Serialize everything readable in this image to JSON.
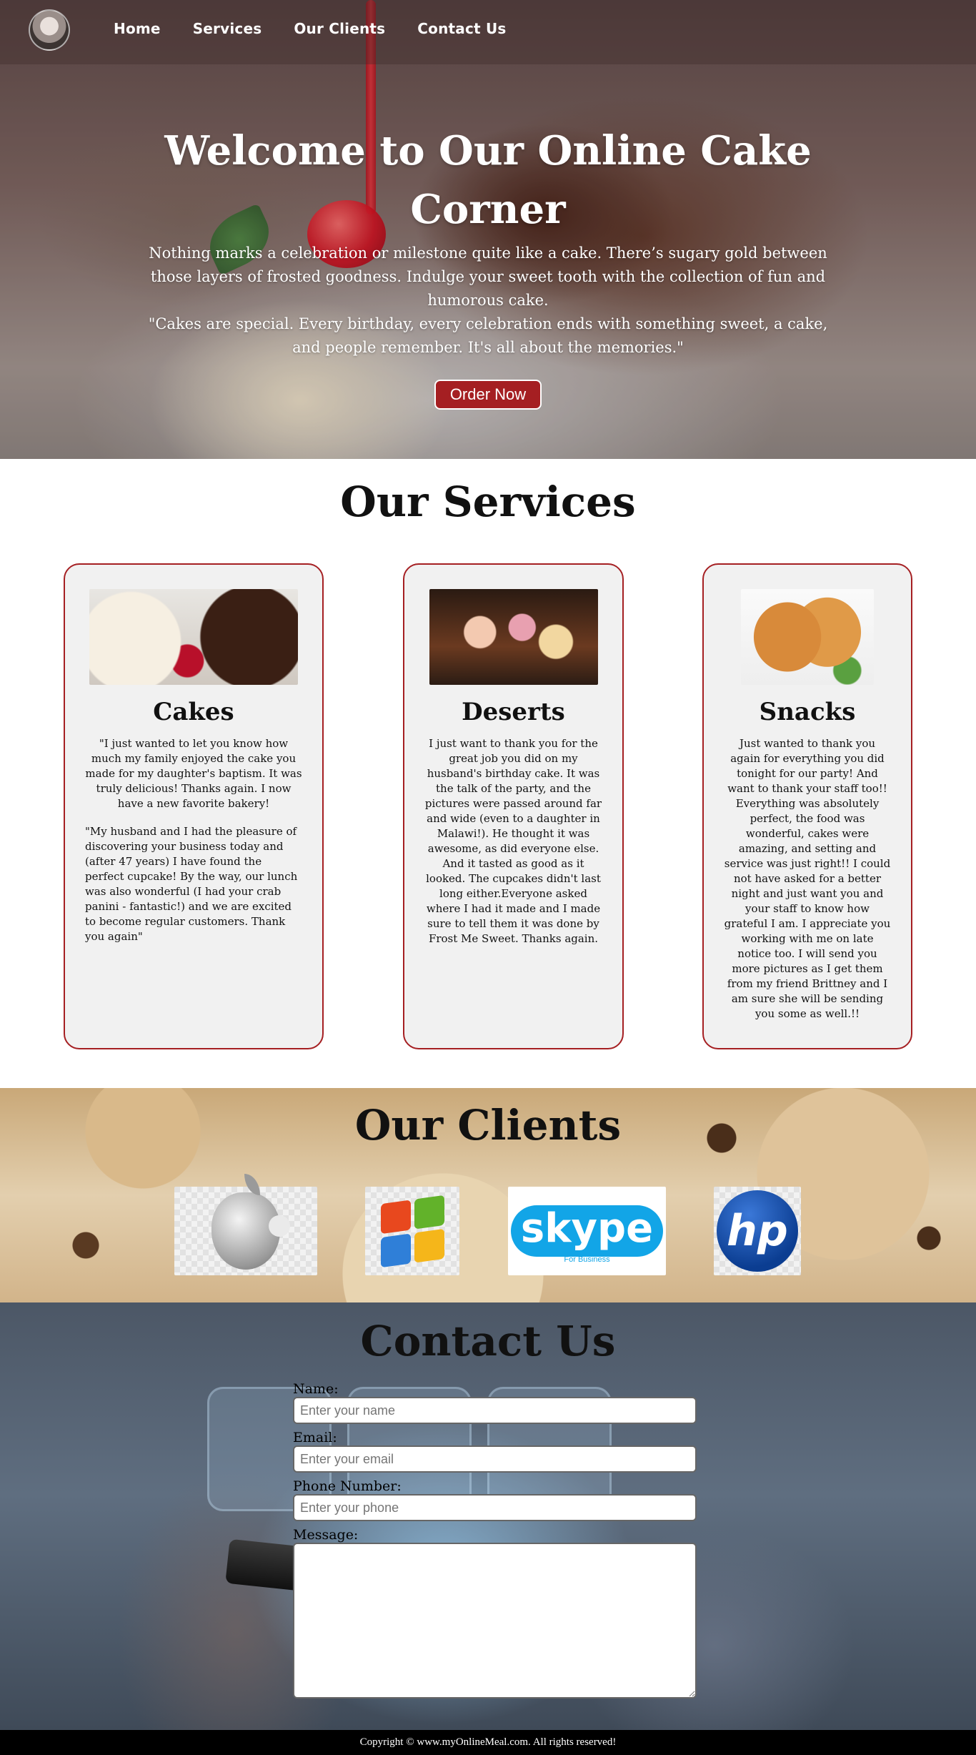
{
  "nav": {
    "avatar_icon": "profile-avatar",
    "links": [
      "Home",
      "Services",
      "Our Clients",
      "Contact Us"
    ]
  },
  "hero": {
    "title": "Welcome to Our Online Cake Corner",
    "paragraph": "Nothing marks a celebration or milestone quite like a cake. There’s sugary gold between those layers of frosted goodness. Indulge your sweet tooth with the collection of fun and humorous cake.",
    "quote": "\"Cakes are special. Every birthday, every celebration ends with something sweet, a cake, and people remember. It's all about the memories.\"",
    "button_label": "Order Now",
    "accent_color": "#a51f22"
  },
  "services": {
    "title": "Our Services",
    "cards": [
      {
        "title": "Cakes",
        "texts": [
          "\"I just wanted to let you know how much my family enjoyed the cake you made for my daughter's baptism. It was truly delicious! Thanks again. I now have a new favorite bakery!",
          "\"My husband and I had the pleasure of discovering your business today and (after 47 years) I have found the perfect cupcake! By the way, our lunch was also wonderful (I had your crab panini - fantastic!) and we are excited to become regular customers. Thank you again\""
        ]
      },
      {
        "title": "Deserts",
        "texts": [
          "I just want to thank you for the great job you did on my husband's birthday cake. It was the talk of the party, and the pictures were passed around far and wide (even to a daughter in Malawi!). He thought it was awesome, as did everyone else. And it tasted as good as it looked. The cupcakes didn't last long either.Everyone asked where I had it made and I made sure to tell them it was done by Frost Me Sweet. Thanks again."
        ]
      },
      {
        "title": "Snacks",
        "texts": [
          "Just wanted to thank you again for everything you did tonight for our party! And want to thank your staff too!! Everything was absolutely perfect, the food was wonderful, cakes were amazing, and setting and service was just right!! I could not have asked for a better night and just want you and your staff to know how grateful I am. I appreciate you working with me on late notice too. I will send you more pictures as I get them from my friend Brittney and I am sure she will be sending you some as well.!!"
        ]
      }
    ]
  },
  "clients": {
    "title": "Our Clients",
    "logos": [
      "apple-logo",
      "windows-logo",
      "skype-logo",
      "hp-logo"
    ],
    "skype_word": "skype",
    "skype_sub": "For Business",
    "hp_word": "hp"
  },
  "contact": {
    "title": "Contact Us",
    "fields": {
      "name_label": "Name:",
      "name_placeholder": "Enter your name",
      "email_label": "Email:",
      "email_placeholder": "Enter your email",
      "phone_label": "Phone Number:",
      "phone_placeholder": "Enter your phone",
      "message_label": "Message:"
    }
  },
  "footer": {
    "text": "Copyright © www.myOnlineMeal.com. All rights reserved!"
  }
}
